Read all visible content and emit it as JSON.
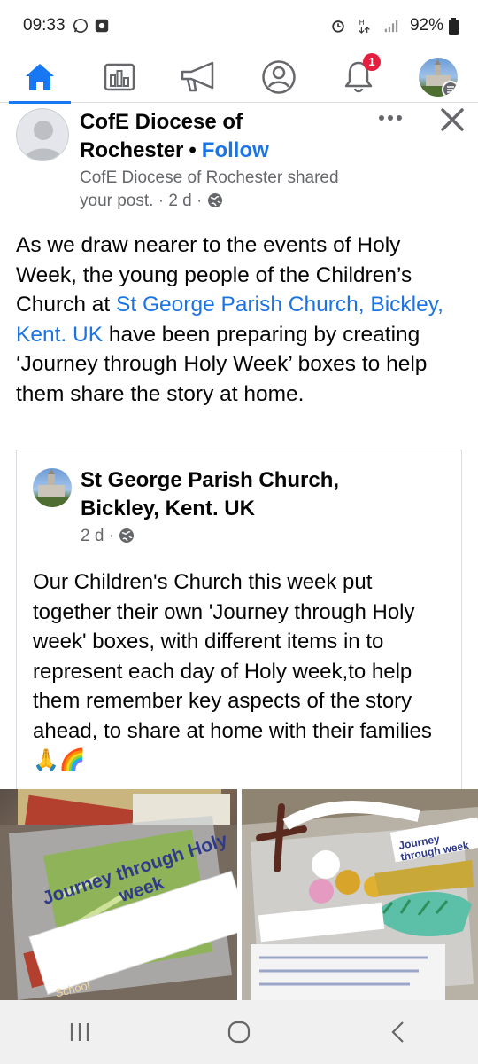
{
  "status_bar": {
    "time": "09:33",
    "battery": "92%",
    "icons": [
      "whatsapp-icon",
      "notification-dot-icon",
      "alarm-icon",
      "data-icon",
      "signal-icon",
      "battery-icon"
    ]
  },
  "nav": {
    "tabs": [
      "home-icon",
      "feeds-icon",
      "megaphone-icon",
      "profile-icon",
      "bell-icon",
      "menu-avatar"
    ],
    "notification_count": "1",
    "active_tab": "home",
    "accent": "#1877f2"
  },
  "post": {
    "page_name": "CofE Diocese of Rochester",
    "dot": "•",
    "follow_label": "Follow",
    "shared_line": "CofE Diocese of Rochester shared your post. · 2 d ·",
    "text_before": "As we draw nearer to the events of Holy Week, the young people of the Children’s Church at ",
    "link": "St George Parish Church, Bickley, Kent. UK",
    "text_after": " have been preparing by creating ‘Journey through Holy Week’ boxes to help them share the story at home."
  },
  "shared": {
    "name": "St George Parish Church, Bickley, Kent. UK",
    "meta": "2 d ·",
    "text": "Our Children's Church this week put together their own 'Journey through Holy week' boxes, with different items in to represent each day of Holy week,to help them remember key aspects of the story ahead, to share at home with their families🙏🌈"
  },
  "photos": {
    "left_label_line1": "Journey through Holy",
    "left_label_line2": "week",
    "left_sign": "School",
    "right_label": "Journey through week"
  }
}
